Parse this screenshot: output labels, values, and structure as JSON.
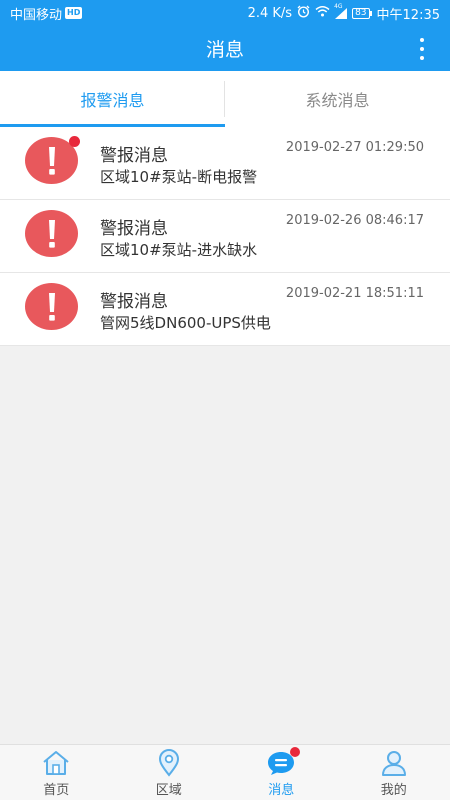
{
  "status_bar": {
    "carrier": "中国移动",
    "hd": "HD",
    "speed": "2.4 K/s",
    "signal_label": "4G",
    "battery": "83",
    "time": "中午12:35"
  },
  "app_bar": {
    "title": "消息",
    "more_icon": "more-vertical-icon"
  },
  "tabs": [
    {
      "label": "报警消息",
      "active": true
    },
    {
      "label": "系统消息",
      "active": false
    }
  ],
  "messages": [
    {
      "title": "警报消息",
      "detail": "区域10#泵站-断电报警",
      "time": "2019-02-27 01:29:50",
      "unread": true
    },
    {
      "title": "警报消息",
      "detail": "区域10#泵站-进水缺水",
      "time": "2019-02-26 08:46:17",
      "unread": false
    },
    {
      "title": "警报消息",
      "detail": "管网5线DN600-UPS供电",
      "time": "2019-02-21 18:51:11",
      "unread": false
    }
  ],
  "bottom_nav": [
    {
      "label": "首页",
      "icon": "home-icon",
      "active": false
    },
    {
      "label": "区域",
      "icon": "location-pin-icon",
      "active": false
    },
    {
      "label": "消息",
      "icon": "message-icon",
      "active": true,
      "badge": true
    },
    {
      "label": "我的",
      "icon": "user-icon",
      "active": false
    }
  ],
  "colors": {
    "primary": "#1e9bf0",
    "alert": "#e8585c",
    "badge": "#e8283b"
  }
}
